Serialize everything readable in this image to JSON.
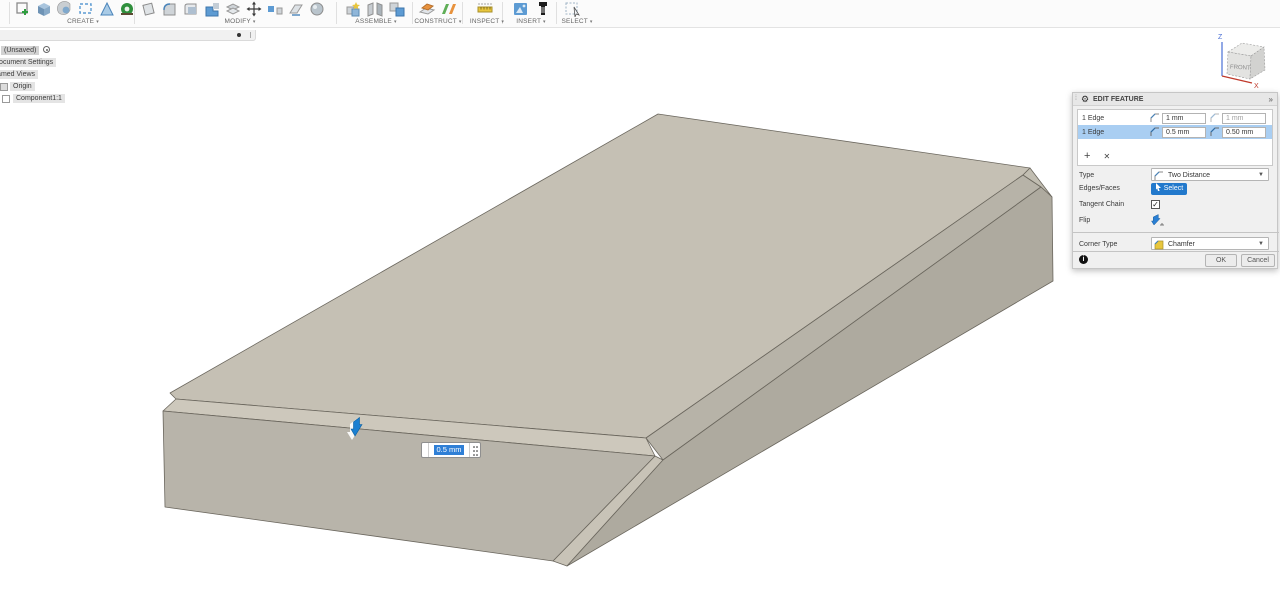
{
  "colors": {
    "accent_blue": "#2279cc",
    "selection_blue": "#a9cef2",
    "model_top": "#c5c0b4",
    "model_front": "#b8b4aa"
  },
  "toolbar": {
    "caret": "▾",
    "groups": [
      {
        "label": "CREATE"
      },
      {
        "label": "MODIFY"
      },
      {
        "label": "ASSEMBLE"
      },
      {
        "label": "CONSTRUCT"
      },
      {
        "label": "INSPECT"
      },
      {
        "label": "INSERT"
      },
      {
        "label": "SELECT"
      }
    ]
  },
  "browser": {
    "items": [
      {
        "label": "(Unsaved)"
      },
      {
        "label": "Document Settings"
      },
      {
        "label": "Named Views"
      },
      {
        "label": "Origin"
      },
      {
        "label": "Component1:1"
      }
    ]
  },
  "viewcube": {
    "front": "FRONT",
    "z": "Z",
    "x": "X"
  },
  "canvas": {
    "dimension_value": "0.5 mm"
  },
  "edit_feature": {
    "title": "EDIT FEATURE",
    "collapse_glyph": "»",
    "rows": [
      {
        "edges": "1 Edge",
        "distance1": "1 mm",
        "distance2": "1 mm"
      },
      {
        "edges": "1 Edge",
        "distance1": "0.5 mm",
        "distance2": "0.50 mm"
      }
    ],
    "add_label": "+",
    "remove_label": "✕",
    "type_label": "Type",
    "type_value": "Two Distance",
    "edges_faces_label": "Edges/Faces",
    "select_button": "Select",
    "tangent_chain_label": "Tangent Chain",
    "tangent_checked_glyph": "✓",
    "flip_label": "Flip",
    "corner_type_label": "Corner Type",
    "corner_type_value": "Chamfer",
    "info_glyph": "i",
    "ok_label": "OK",
    "cancel_label": "Cancel"
  }
}
